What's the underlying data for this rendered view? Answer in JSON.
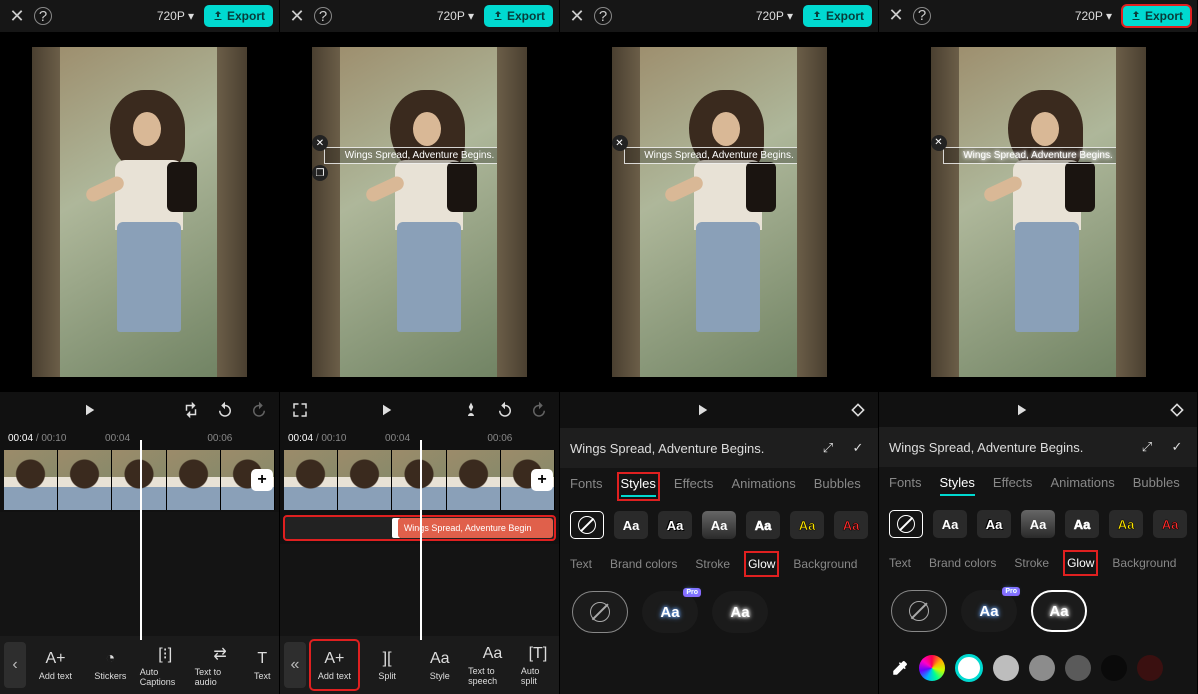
{
  "header": {
    "resolution": "720P ▾",
    "export": "Export"
  },
  "overlay_text": "Wings Spread, Adventure Begins.",
  "timeline": {
    "current": "00:04",
    "duration": "/ 00:10",
    "tick_a": "00:04",
    "tick_b": "00:06"
  },
  "clip_label": "Wings Spread, Adventure Begin",
  "tools1": {
    "add_text": "Add text",
    "stickers": "Stickers",
    "auto_captions": "Auto Captions",
    "text_to_audio": "Text to audio",
    "text": "Text"
  },
  "tools2": {
    "add_text": "Add text",
    "split": "Split",
    "style": "Style",
    "text_to_speech": "Text to speech",
    "auto_split": "Auto split"
  },
  "text_input": "Wings Spread, Adventure Begins.",
  "tabs": {
    "fonts": "Fonts",
    "styles": "Styles",
    "effects": "Effects",
    "animations": "Animations",
    "bubbles": "Bubbles"
  },
  "subtabs": {
    "text": "Text",
    "brand": "Brand colors",
    "stroke": "Stroke",
    "glow": "Glow",
    "background": "Background"
  },
  "style_sample": "Aa",
  "glow_pro": "Pro"
}
